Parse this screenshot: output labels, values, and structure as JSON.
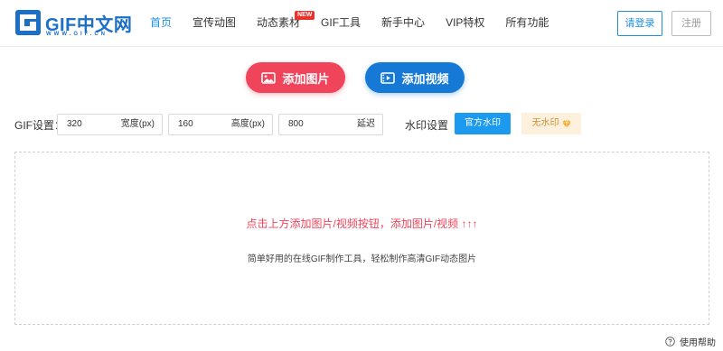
{
  "header": {
    "logo_text": "GIF中文网",
    "logo_sub": "WWW.GIF.CN",
    "nav": [
      {
        "label": "首页",
        "active": true
      },
      {
        "label": "宣传动图",
        "active": false
      },
      {
        "label": "动态素材",
        "active": false,
        "badge": "NEW"
      },
      {
        "label": "GIF工具",
        "active": false
      },
      {
        "label": "新手中心",
        "active": false
      },
      {
        "label": "VIP特权",
        "active": false
      },
      {
        "label": "所有功能",
        "active": false
      }
    ],
    "login_label": "请登录",
    "register_label": "注册"
  },
  "actions": {
    "add_image_label": "添加图片",
    "add_video_label": "添加视频"
  },
  "settings": {
    "label": "GIF设置：",
    "width": {
      "value": "320",
      "unit": "宽度(px)"
    },
    "height": {
      "value": "160",
      "unit": "高度(px)"
    },
    "delay": {
      "value": "800",
      "unit": "延迟"
    },
    "watermark_label": "水印设置",
    "watermark_official_label": "官方水印",
    "watermark_none_label": "无水印"
  },
  "dropzone": {
    "tip": "点击上方添加图片/视频按钮，添加图片/视频 ↑↑↑",
    "subtitle": "简单好用的在线GIF制作工具，轻松制作高清GIF动态图片"
  },
  "help_label": "使用帮助",
  "colors": {
    "brand": "#1b6fc7",
    "accent_blue": "#1e8fe1",
    "accent_red": "#f0445a",
    "new_badge": "#e8332c"
  }
}
